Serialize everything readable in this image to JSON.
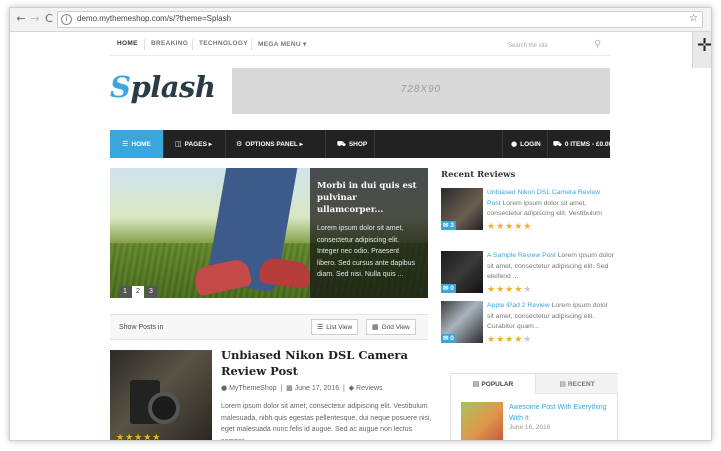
{
  "browser": {
    "url": "demo.mythemeshop.com/s/?theme=Splash",
    "back": "←",
    "forward": "→",
    "reload": "C",
    "info": "i",
    "star": "☆"
  },
  "topnav": {
    "items": [
      "HOME",
      "BREAKING",
      "TECHNOLOGY",
      "MEGA MENU ▾"
    ],
    "search_placeholder": "Search the site"
  },
  "logo": {
    "first": "S",
    "rest": "plash"
  },
  "ad": {
    "label": "728X90"
  },
  "mainnav": {
    "home": "HOME",
    "pages": "PAGES ▸",
    "options": "OPTIONS PANEL ▸",
    "shop": "SHOP",
    "login": "LOGIN",
    "cart": "0 ITEMS - £0.00"
  },
  "slider": {
    "title": "Morbi in dui quis est pulvinar ullamcorper...",
    "text": "Lorem ipsum dolor sit amet, consectetur adipiscing elit. Integer nec odio. Praesent libero. Sed cursus ante dapibus diam. Sed nisi. Nulla quis ...",
    "pager": [
      "1",
      "2",
      "3"
    ]
  },
  "showbar": {
    "label": "Show Posts in",
    "list_view": "List View",
    "grid_view": "Grid View"
  },
  "post": {
    "title": "Unbiased Nikon DSL Camera Review Post",
    "author": "MyThemeShop",
    "date": "June 17, 2016",
    "category": "Reviews",
    "excerpt": "Lorem ipsum dolor sit amet, consectetur adipiscing elit. Vestibulum malesuada, nibh quis egestas pellentesque, dui neque posuere nisi, eget malesuada nunc felis id augue. Sed ac augue non lectus semper..."
  },
  "sidebar": {
    "title": "Recent Reviews",
    "reviews": [
      {
        "link": "Unbiased Nikon DSL Camera Review Post",
        "text": "Lorem ipsum dolor sit amet, consectetur adipiscing elit. Vestibulum malesuada...",
        "badge": "3",
        "rating": 5
      },
      {
        "link": "A Sample Review Post",
        "text": "Lorem ipsum dolor sit amet, consectetur adipiscing elit. Sed eleifend ...",
        "badge": "0",
        "rating": 4
      },
      {
        "link": "Apple iPad 2 Review",
        "text": "Lorem ipsum dolor sit amet, consectetur adipiscing elit. Curabitur quam...",
        "badge": "0",
        "rating": 4
      }
    ],
    "tabs": {
      "popular": "POPULAR",
      "recent": "RECENT",
      "popular_post": {
        "title": "Awesome Post With Everything With It",
        "date": "June 16, 2016"
      }
    }
  },
  "colors": {
    "accent": "#3aa6dc",
    "nav_bg": "#222222",
    "stars": "#f2b01e"
  }
}
